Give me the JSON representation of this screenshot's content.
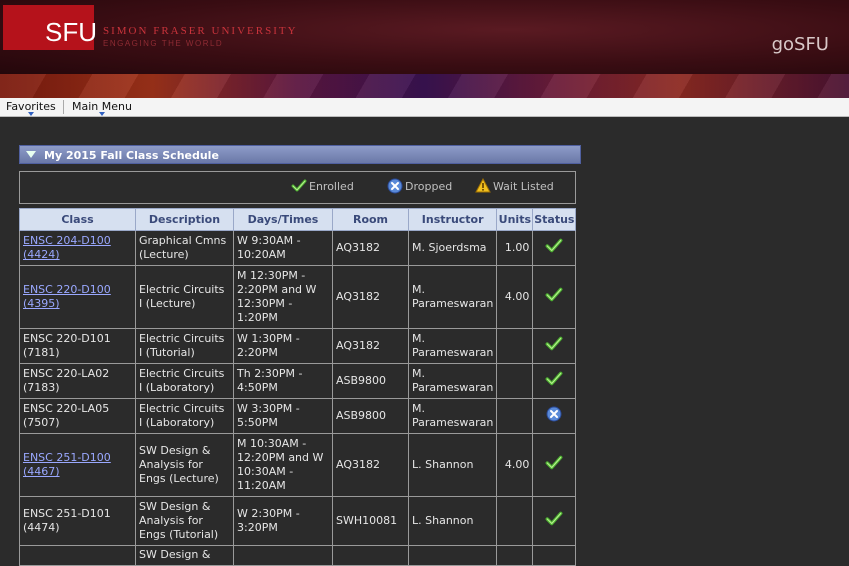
{
  "banner": {
    "logo_text": "SFU",
    "university_name": "SIMON FRASER UNIVERSITY",
    "tagline": "ENGAGING THE WORLD",
    "app_title": "goSFU"
  },
  "menu": {
    "favorites": "Favorites",
    "main_menu": "Main Menu"
  },
  "section": {
    "title": "My 2015 Fall Class Schedule"
  },
  "legend": {
    "enrolled": "Enrolled",
    "dropped": "Dropped",
    "wait_listed": "Wait Listed",
    "enrolled_icon": "checkmark-icon",
    "dropped_icon": "x-circle-icon",
    "wait_listed_icon": "warning-triangle-icon"
  },
  "colors": {
    "link": "#9aa8ff",
    "header_bar": "#7a88b8",
    "enrolled_green": "#4caf30",
    "dropped_blue": "#5a8ad8",
    "wait_yellow": "#f0c020",
    "brand_red": "#b5121b"
  },
  "table": {
    "headers": {
      "class": "Class",
      "description": "Description",
      "days_times": "Days/Times",
      "room": "Room",
      "instructor": "Instructor",
      "units": "Units",
      "status": "Status"
    },
    "rows": [
      {
        "class_line1": "ENSC 204-D100",
        "class_line2": "(4424)",
        "link": true,
        "description": "Graphical Cmns (Lecture)",
        "days_times": "W 9:30AM - 10:20AM",
        "room": "AQ3182",
        "instructor": "M. Sjoerdsma",
        "units": "1.00",
        "status": "enrolled"
      },
      {
        "class_line1": "ENSC 220-D100",
        "class_line2": "(4395)",
        "link": true,
        "description": "Electric Circuits I (Lecture)",
        "days_times": "M 12:30PM - 2:20PM and  W 12:30PM - 1:20PM",
        "room": "AQ3182",
        "instructor": "M. Parameswaran",
        "units": "4.00",
        "status": "enrolled"
      },
      {
        "class_line1": "ENSC 220-D101",
        "class_line2": "(7181)",
        "link": false,
        "description": "Electric Circuits I (Tutorial)",
        "days_times": "W 1:30PM - 2:20PM",
        "room": "AQ3182",
        "instructor": "M. Parameswaran",
        "units": "",
        "status": "enrolled"
      },
      {
        "class_line1": "ENSC 220-LA02",
        "class_line2": "(7183)",
        "link": false,
        "description": "Electric Circuits I (Laboratory)",
        "days_times": "Th 2:30PM - 4:50PM",
        "room": "ASB9800",
        "instructor": "M. Parameswaran",
        "units": "",
        "status": "enrolled"
      },
      {
        "class_line1": "ENSC 220-LA05",
        "class_line2": "(7507)",
        "link": false,
        "description": "Electric Circuits I (Laboratory)",
        "days_times": "W 3:30PM - 5:50PM",
        "room": "ASB9800",
        "instructor": "M. Parameswaran",
        "units": "",
        "status": "dropped"
      },
      {
        "class_line1": "ENSC 251-D100",
        "class_line2": "(4467)",
        "link": true,
        "description": "SW Design & Analysis for Engs (Lecture)",
        "days_times": "M 10:30AM - 12:20PM and  W 10:30AM - 11:20AM",
        "room": "AQ3182",
        "instructor": "L. Shannon",
        "units": "4.00",
        "status": "enrolled"
      },
      {
        "class_line1": "ENSC 251-D101",
        "class_line2": "(4474)",
        "link": false,
        "description": "SW Design & Analysis for Engs (Tutorial)",
        "days_times": "W 2:30PM - 3:20PM",
        "room": "SWH10081",
        "instructor": "L. Shannon",
        "units": "",
        "status": "enrolled"
      },
      {
        "class_line1": "",
        "class_line2": "",
        "link": false,
        "description": "SW Design &",
        "days_times": "",
        "room": "",
        "instructor": "",
        "units": "",
        "status": ""
      }
    ]
  }
}
